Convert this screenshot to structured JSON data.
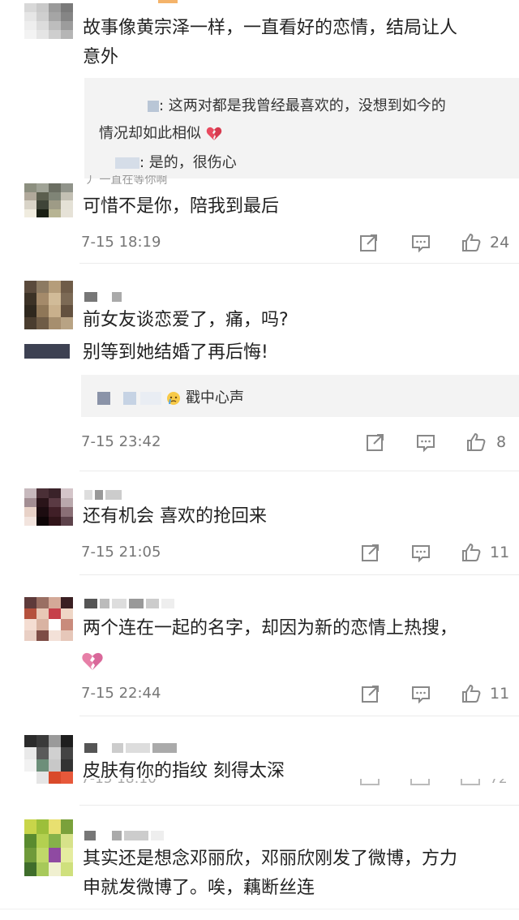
{
  "comments": [
    {
      "text_lines": [
        "故事像黄宗泽一样，一直看好的恋情，结局让人",
        "意外"
      ],
      "reply": {
        "line1": ": 这两对都是我曾经最喜欢的，没想到如今的",
        "line2": "情况却如此相似",
        "line3": ": 是的，很伤心"
      }
    },
    {
      "text_lines": [
        "可惜不是你，陪我到最后"
      ],
      "time": "7-15 18:19",
      "likes": "24"
    },
    {
      "text_lines": [
        "前女友谈恋爱了，痛，吗?",
        "别等到她结婚了再后悔!"
      ],
      "reply": {
        "line1": "戳中心声"
      },
      "time": "7-15 23:42",
      "likes": "8"
    },
    {
      "text_lines": [
        "还有机会  喜欢的抢回来"
      ],
      "time": "7-15 21:05",
      "likes": "11"
    },
    {
      "text_lines": [
        "两个连在一起的名字，却因为新的恋情上热搜，"
      ],
      "time": "7-15 22:44",
      "likes": "11"
    },
    {
      "text_lines": [
        "皮肤有你的指纹  刻得太深"
      ]
    },
    {
      "text_lines": [
        "其实还是想念邓丽欣，邓丽欣刚发了微博，方力",
        "申就发微博了。唉，藕断丝连"
      ]
    }
  ],
  "icons": {
    "share": "share-icon",
    "comment": "comment-icon",
    "like": "thumbs-up-icon",
    "broken_heart": "broken-heart-emoji",
    "crying_face": "crying-face-emoji"
  },
  "colors": {
    "text": "#222222",
    "meta": "#777777",
    "reply_bg": "#f3f3f3",
    "heart_red": "#e84a5f",
    "heart_pink": "#e77fa7"
  }
}
